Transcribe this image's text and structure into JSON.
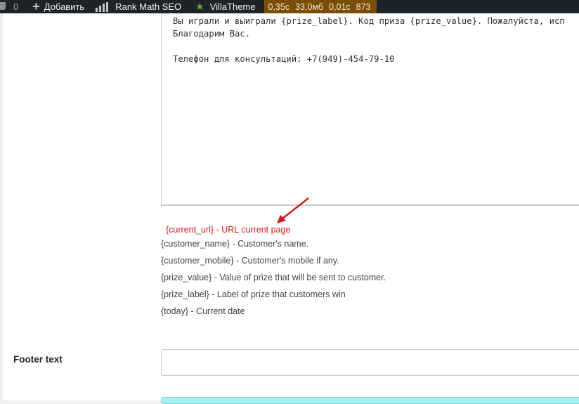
{
  "admin_bar": {
    "comment_count": "0",
    "add_new_label": "Добавить",
    "rank_math_label": "Rank Math SEO",
    "villatheme_label": "VillaTheme",
    "query_monitor": [
      "0,35с",
      "33,0мб",
      "0,01с",
      "873"
    ]
  },
  "email_content": {
    "lines": [
      "Вы играли и выиграли {prize_label}. Код приза {prize_value}. Пожалуйста, исп",
      "Благодарим Вас.",
      "",
      "Телефон для консультаций: +7(949)-454-79-10"
    ]
  },
  "shortcodes": {
    "highlighted": "{current_url} - URL current page",
    "items": [
      "{customer_name} - Customer's name.",
      "{customer_mobile} - Customer's mobile if any.",
      "{prize_value} - Value of prize that will be sent to customer.",
      "{prize_label} - Label of prize that customers win",
      "{today} - Current date"
    ]
  },
  "footer": {
    "label": "Footer text",
    "value": ""
  },
  "colors": {
    "admin_bar_bg": "#1d2327",
    "query_monitor_bg": "#7b4e07",
    "annotation_red": "#d11a1a",
    "villatheme_star": "#5fb23b",
    "bottom_button": "#a4f1ef"
  },
  "icons": [
    "comment-icon",
    "plus-icon",
    "rank-math-icon",
    "star-icon",
    "arrow-annotation-icon"
  ]
}
